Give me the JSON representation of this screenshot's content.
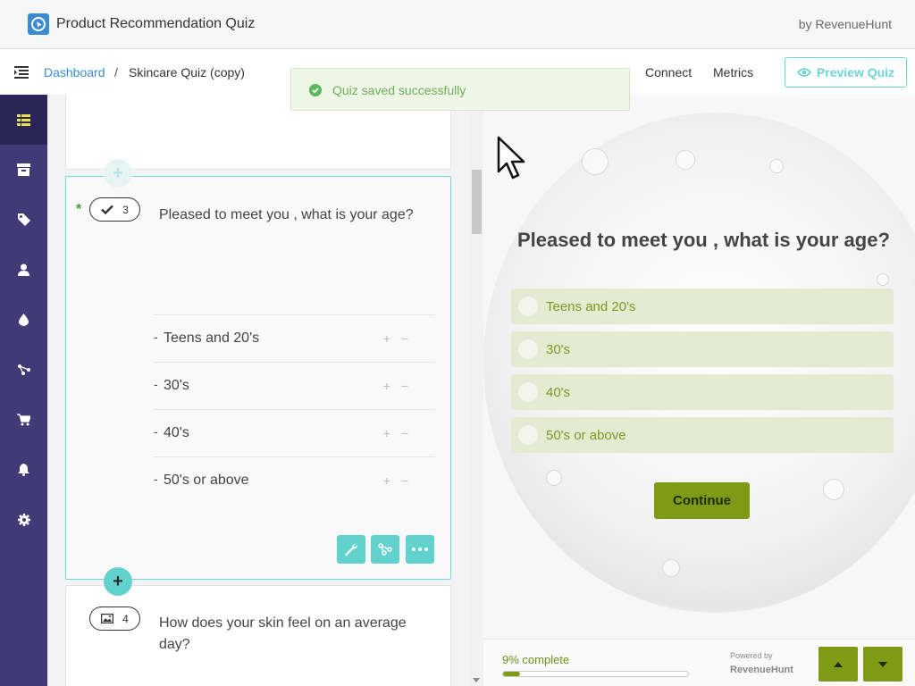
{
  "app": {
    "title": "Product Recommendation Quiz",
    "byline": "by RevenueHunt"
  },
  "breadcrumb": {
    "root": "Dashboard",
    "separator": "/",
    "current": "Skincare Quiz (copy)"
  },
  "header_nav": {
    "connect": "Connect",
    "metrics": "Metrics",
    "preview": "Preview Quiz"
  },
  "toast": {
    "message": "Quiz saved successfully"
  },
  "sidebar": {
    "items": [
      {
        "icon": "list-icon",
        "active": true
      },
      {
        "icon": "box-icon",
        "active": false
      },
      {
        "icon": "tag-icon",
        "active": false
      },
      {
        "icon": "user-icon",
        "active": false
      },
      {
        "icon": "drop-icon",
        "active": false
      },
      {
        "icon": "flow-icon",
        "active": false
      },
      {
        "icon": "cart-icon",
        "active": false
      },
      {
        "icon": "bell-icon",
        "active": false
      },
      {
        "icon": "gear-icon",
        "active": false
      }
    ]
  },
  "editor": {
    "active_question": {
      "required_mark": "*",
      "number": "3",
      "type_icon": "check-icon",
      "text": "Pleased to meet you , what is your age?",
      "answers": [
        {
          "dash": "-",
          "text": "Teens and 20's",
          "controls": "+ −"
        },
        {
          "dash": "-",
          "text": "30's",
          "controls": "+ −"
        },
        {
          "dash": "-",
          "text": "40's",
          "controls": "+ −"
        },
        {
          "dash": "-",
          "text": "50's or above",
          "controls": "+ −"
        }
      ],
      "tools": [
        "wrench-icon",
        "branch-icon",
        "more-icon"
      ]
    },
    "add_label": "+",
    "next_question": {
      "number": "4",
      "type_icon": "image-icon",
      "text": "How does your skin feel on an average day?"
    }
  },
  "preview": {
    "question": "Pleased to meet you , what is your age?",
    "options": [
      "Teens and 20's",
      "30's",
      "40's",
      "50's or above"
    ],
    "continue_label": "Continue",
    "progress_text": "9% complete",
    "progress_value": 0.09,
    "powered_by": "Powered by",
    "brand": "RevenueHunt"
  },
  "colors": {
    "sidebar": "#413a77",
    "accent_teal": "#62d2cf",
    "quiz_green": "#7f9a17",
    "link_blue": "#3a8bd1"
  }
}
